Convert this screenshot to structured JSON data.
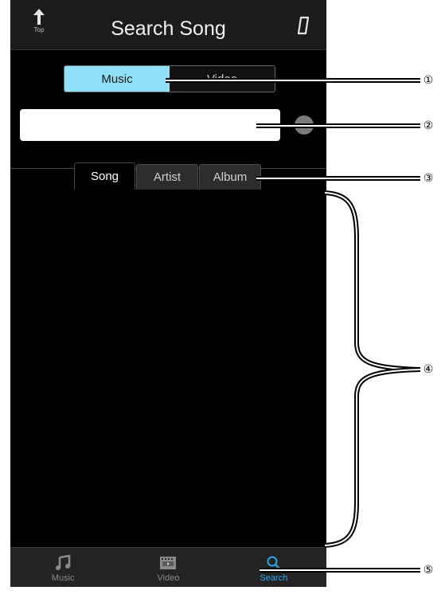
{
  "header": {
    "top_button_label": "Top",
    "title": "Search Song",
    "top_icon": "up-arrow-icon",
    "device_icon": "phone-device-icon"
  },
  "media_switch": {
    "options": [
      "Music",
      "Video"
    ],
    "selected": "Music"
  },
  "search": {
    "value": "",
    "placeholder": ""
  },
  "search_tabs": [
    {
      "label": "Song",
      "active": true
    },
    {
      "label": "Artist",
      "active": false
    },
    {
      "label": "Album",
      "active": false
    }
  ],
  "tab_bar": {
    "items": [
      {
        "label": "Music",
        "icon": "music-note-icon",
        "active": false
      },
      {
        "label": "Video",
        "icon": "film-icon",
        "active": false
      },
      {
        "label": "Search",
        "icon": "magnifier-icon",
        "active": true
      }
    ]
  },
  "callouts": [
    "①",
    "②",
    "③",
    "④",
    "⑤"
  ],
  "colors": {
    "accent": "#2ea3e8",
    "segment_selected": "#8fe0f6",
    "background": "#000000"
  }
}
